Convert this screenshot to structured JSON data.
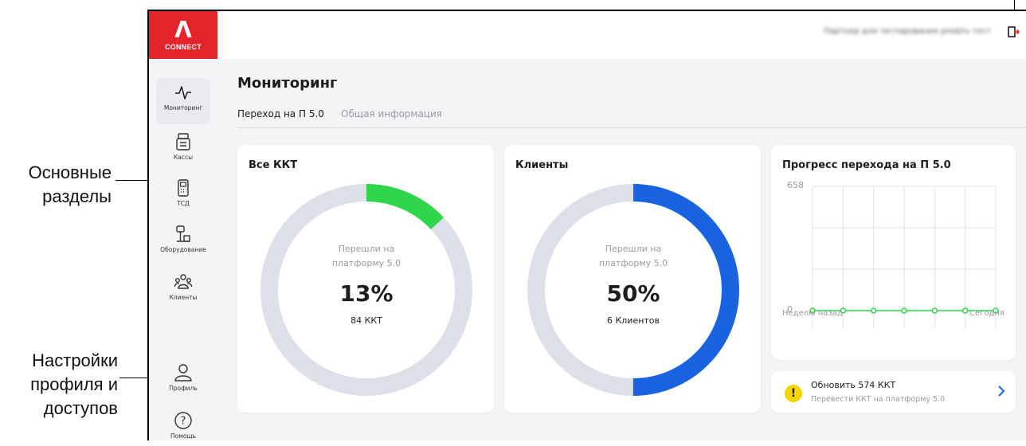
{
  "annotations": {
    "sections_line1": "Основные",
    "sections_line2": "разделы",
    "profile_line1": "Настройки",
    "profile_line2": "профиля и",
    "profile_line3": "доступов"
  },
  "logo": {
    "mark": "Λ",
    "text": "CONNECT"
  },
  "topbar": {
    "partner_name": "Партнер для тестирования prod/ru тест"
  },
  "sidebar": {
    "items": [
      {
        "label": "Мониторинг",
        "icon": "pulse-icon",
        "active": true
      },
      {
        "label": "Кассы",
        "icon": "cash-register-icon"
      },
      {
        "label": "ТСД",
        "icon": "scanner-terminal-icon"
      },
      {
        "label": "Оборудование",
        "icon": "equipment-icon"
      },
      {
        "label": "Клиенты",
        "icon": "clients-icon"
      }
    ],
    "bottom": [
      {
        "label": "Профиль",
        "icon": "profile-icon"
      },
      {
        "label": "Помощь",
        "icon": "help-icon"
      }
    ]
  },
  "page": {
    "title": "Мониторинг",
    "tabs": [
      {
        "label": "Переход на П 5.0",
        "active": true
      },
      {
        "label": "Общая информация",
        "active": false
      }
    ]
  },
  "cards": {
    "all_kkt": {
      "title": "Все ККТ",
      "caption_line1": "Перешли на",
      "caption_line2": "платформу 5.0",
      "percent": "13%",
      "sub": "84 ККТ",
      "fraction": 0.13,
      "color": "#2fd64c"
    },
    "clients": {
      "title": "Клиенты",
      "caption_line1": "Перешли на",
      "caption_line2": "платформу 5.0",
      "percent": "50%",
      "sub": "6 Клиентов",
      "fraction": 0.5,
      "color": "#1a63e0"
    },
    "progress": {
      "title": "Прогресс перехода на П 5.0",
      "y_max_label": "658",
      "y_min_label": "0",
      "x_start_label": "Неделю назад",
      "x_end_label": "Сегодня"
    },
    "update": {
      "title": "Обновить 574 ККТ",
      "subtitle": "Перевести ККТ на платформу 5.0"
    }
  },
  "colors": {
    "brand": "#e3242b",
    "track": "#dde0e8",
    "line": "#2fd64c"
  },
  "chart_data": {
    "type": "line",
    "title": "Прогресс перехода на П 5.0",
    "x": [
      "Неделю назад",
      "",
      "",
      "",
      "",
      "",
      "Сегодня"
    ],
    "series": [
      {
        "values": [
          0,
          0,
          0,
          0,
          0,
          0,
          0
        ]
      }
    ],
    "ylim": [
      0,
      658
    ],
    "grid": true
  }
}
